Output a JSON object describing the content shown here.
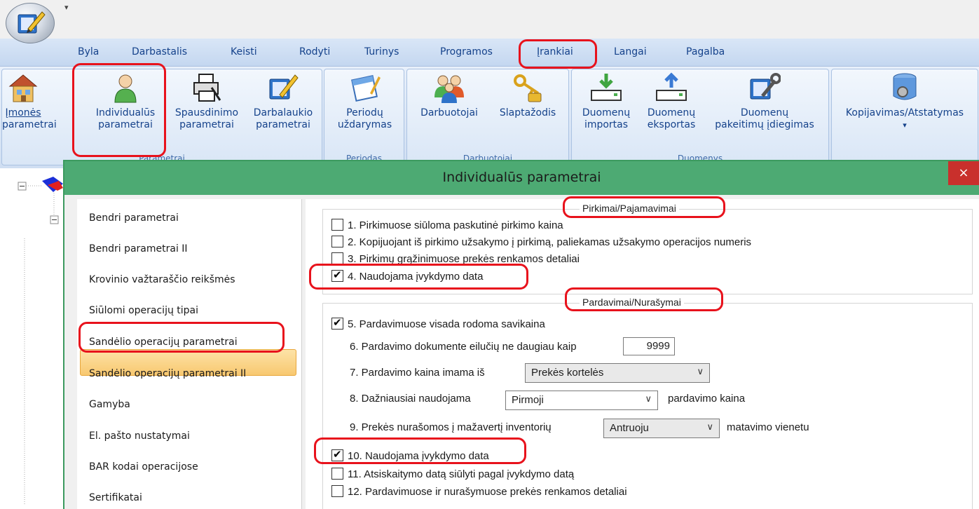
{
  "qat": {
    "dropdown": "▾"
  },
  "menu": [
    "Byla",
    "Darbastalis",
    "Keisti",
    "Rodyti",
    "Turinys",
    "Programos",
    "Įrankiai",
    "Langai",
    "Pagalba"
  ],
  "ribbon": {
    "groups": [
      {
        "label": "Parametrai",
        "buttons": [
          {
            "line1": "Įmonės",
            "line2": "parametrai",
            "icon": "house-icon"
          },
          {
            "line1": "Individualūs",
            "line2": "parametrai",
            "icon": "person-icon"
          },
          {
            "line1": "Spausdinimo",
            "line2": "parametrai",
            "icon": "printer-icon"
          },
          {
            "line1": "Darbalaukio",
            "line2": "parametrai",
            "icon": "desktop-pen-icon"
          }
        ]
      },
      {
        "label": "Periodas",
        "buttons": [
          {
            "line1": "Periodų",
            "line2": "uždarymas",
            "icon": "calendar-icon"
          }
        ]
      },
      {
        "label": "Darbuotojai",
        "buttons": [
          {
            "line1": "Darbuotojai",
            "line2": "",
            "icon": "people-icon"
          },
          {
            "line1": "Slaptažodis",
            "line2": "",
            "icon": "keys-icon"
          }
        ]
      },
      {
        "label": "Duomenys",
        "buttons": [
          {
            "line1": "Duomenų",
            "line2": "importas",
            "icon": "import-icon"
          },
          {
            "line1": "Duomenų",
            "line2": "eksportas",
            "icon": "export-icon"
          },
          {
            "line1": "Duomenų",
            "line2": "pakeitimų įdiegimas",
            "icon": "wrench-icon"
          }
        ]
      },
      {
        "label": "",
        "buttons": [
          {
            "line1": "Kopijavimas/Atstatymas",
            "line2": "▾",
            "icon": "database-icon"
          }
        ]
      }
    ]
  },
  "dialog": {
    "title": "Individualūs parametrai",
    "close": "×",
    "nav": [
      "Bendri parametrai",
      "Bendri parametrai II",
      "Krovinio važtaraščio reikšmės",
      "Siūlomi operacijų tipai",
      "Sandėlio operacijų parametrai",
      "Sandėlio operacijų parametrai II",
      "Gamyba",
      "El. pašto nustatymai",
      "BAR kodai operacijose",
      "Sertifikatai"
    ],
    "purchases": {
      "legend": "Pirkimai/Pajamavimai",
      "options": [
        {
          "label": "1. Pirkimuose siūloma paskutinė pirkimo kaina",
          "checked": false
        },
        {
          "label": "2. Kopijuojant iš pirkimo užsakymo į pirkimą, paliekamas užsakymo operacijos numeris",
          "checked": false
        },
        {
          "label": "3. Pirkimų grąžinimuose prekės renkamos detaliai",
          "checked": false
        },
        {
          "label": "4. Naudojama įvykdymo data",
          "checked": true
        }
      ]
    },
    "sales": {
      "legend": "Pardavimai/Nurašymai",
      "opt5": {
        "label": "5. Pardavimuose visada rodoma savikaina",
        "checked": true
      },
      "opt6": {
        "label": "6. Pardavimo dokumente eilučių ne daugiau kaip",
        "value": "9999"
      },
      "opt7": {
        "label": "7. Pardavimo kaina imama iš",
        "selected": "Prekės kortelės"
      },
      "opt8": {
        "label": "8. Dažniausiai naudojama",
        "selected": "Pirmoji",
        "suffix": "pardavimo kaina"
      },
      "opt9": {
        "label": "9. Prekės nurašomos į mažavertį inventorių",
        "selected": "Antruoju",
        "suffix": "matavimo vienetu"
      },
      "opt10": {
        "label": "10. Naudojama įvykdymo data",
        "checked": true
      },
      "opt11": {
        "label": "11. Atsiskaitymo datą siūlyti pagal įvykdymo datą",
        "checked": false
      },
      "opt12": {
        "label": "12. Pardavimuose ir nurašymuose prekės renkamos detaliai",
        "checked": false
      }
    }
  }
}
